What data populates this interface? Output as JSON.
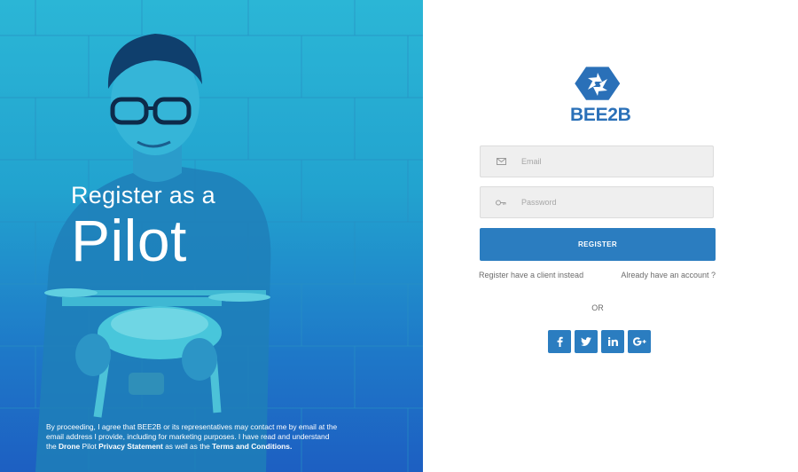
{
  "hero": {
    "subtitle": "Register as a",
    "title": "Pilot",
    "legal": {
      "intro": "By proceeding, I agree that BEE2B or its representatives may contact me by email at the email address I provide, including for marketing purposes. I have read and understand the ",
      "drone": "Drone",
      "pilot": " Pilot ",
      "privacy": "Privacy Statement",
      "as_well": " as well as the ",
      "terms": "Terms and Conditions."
    }
  },
  "brand": {
    "name": "BEE2B",
    "color": "#2a70b8"
  },
  "form": {
    "email_placeholder": "Email",
    "password_placeholder": "Password",
    "register_label": "REGISTER",
    "client_link": "Register have a client instead",
    "account_link": "Already have an account ?",
    "or_label": "OR"
  },
  "social": [
    {
      "icon": "facebook-icon",
      "glyph": "f"
    },
    {
      "icon": "twitter-icon",
      "glyph": "t"
    },
    {
      "icon": "linkedin-icon",
      "glyph": "in"
    },
    {
      "icon": "google-plus-icon",
      "glyph": "G+"
    }
  ],
  "colors": {
    "accent": "#2b7dc0",
    "hero_top": "#2bb6d6",
    "hero_bottom": "#1d5fc2"
  }
}
